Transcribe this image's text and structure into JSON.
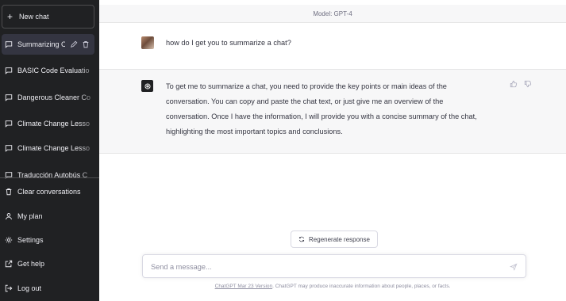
{
  "sidebar": {
    "new_chat": {
      "icon": "plus-icon",
      "label": "New chat"
    },
    "conversations": [
      {
        "label": "Summarizing C",
        "icon": "chat-bubble-icon",
        "active": true
      },
      {
        "label": "BASIC Code Evaluatio",
        "icon": "chat-bubble-icon"
      },
      {
        "label": "Dangerous Cleaner Co",
        "icon": "chat-bubble-icon"
      },
      {
        "label": "Climate Change Lesso",
        "icon": "chat-bubble-icon"
      },
      {
        "label": "Climate Change Lesso",
        "icon": "chat-bubble-icon"
      },
      {
        "label": "Traducción Autobús C",
        "icon": "chat-bubble-icon"
      }
    ],
    "actions": [
      {
        "label": "Clear conversations",
        "icon": "trash-icon"
      },
      {
        "label": "My plan",
        "icon": "user-icon"
      },
      {
        "label": "Settings",
        "icon": "gear-icon"
      },
      {
        "label": "Get help",
        "icon": "external-link-icon"
      },
      {
        "label": "Log out",
        "icon": "logout-icon"
      }
    ]
  },
  "header": {
    "model": "Model: GPT-4"
  },
  "messages": [
    {
      "role": "user",
      "text": "how do I get you to summarize a chat?"
    },
    {
      "role": "assistant",
      "lines": [
        "To get me to summarize a chat, you need to provide the key points or main ideas of the",
        "conversation. You can copy and paste the chat text, or just give me an overview of the",
        "conversation. Once I have the information, I will provide you with a concise summary of the chat,",
        "highlighting the most important topics and conclusions."
      ]
    }
  ],
  "regenerate": {
    "label": "Regenerate response",
    "icon": "refresh-icon"
  },
  "composer": {
    "placeholder": "Send a message...",
    "send_icon": "send-icon"
  },
  "footer": {
    "link": "ChatGPT Mar 23 Version",
    "text": ". ChatGPT may produce inaccurate information about people, places, or facts."
  },
  "colors": {
    "sidebar_bg": "#202123",
    "active_item_bg": "#343541",
    "assistant_bg": "#f7f7f8"
  }
}
